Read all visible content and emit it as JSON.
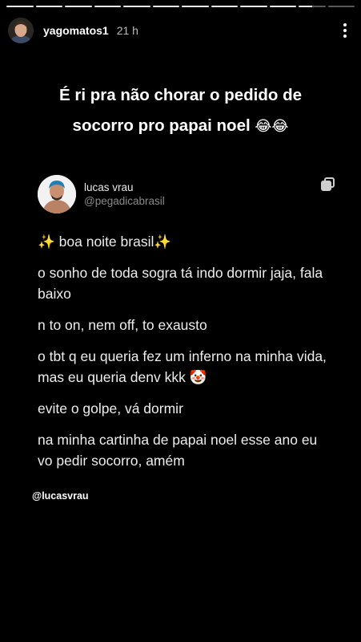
{
  "story": {
    "progress": [
      1,
      1,
      1,
      1,
      1,
      1,
      1,
      1,
      1,
      1,
      0.5,
      0
    ]
  },
  "header": {
    "username": "yagomatos1",
    "time": "21 h",
    "avatar_icon": "profile-avatar",
    "more_icon": "more-dots-icon"
  },
  "caption": {
    "line1": "É ri pra não chorar o pedido de",
    "line2": "socorro pro papai noel",
    "emoji": "😂😂"
  },
  "tweet": {
    "name": "lucas vrau",
    "handle": "@pegadicabrasil",
    "copy_icon": "copy-icon",
    "lines": [
      {
        "pre": "✨",
        "text": " boa noite brasil",
        "post": "✨"
      },
      {
        "pre": "",
        "text": "o sonho de toda sogra tá indo dormir jaja, fala baixo",
        "post": ""
      },
      {
        "pre": "",
        "text": "n to on, nem off, to exausto",
        "post": ""
      },
      {
        "pre": "",
        "text": "o tbt q eu queria fez um inferno na minha vida, mas eu queria denv kkk ",
        "post": "🤡"
      },
      {
        "pre": "",
        "text": "evite o golpe, vá dormir",
        "post": ""
      },
      {
        "pre": "",
        "text": "na minha cartinha de papai noel esse ano eu vo pedir socorro, amém",
        "post": ""
      }
    ]
  },
  "mention": "@lucasvrau",
  "colors": {
    "background": "#000000",
    "text": "#ffffff",
    "handle": "#8a8a8a"
  }
}
